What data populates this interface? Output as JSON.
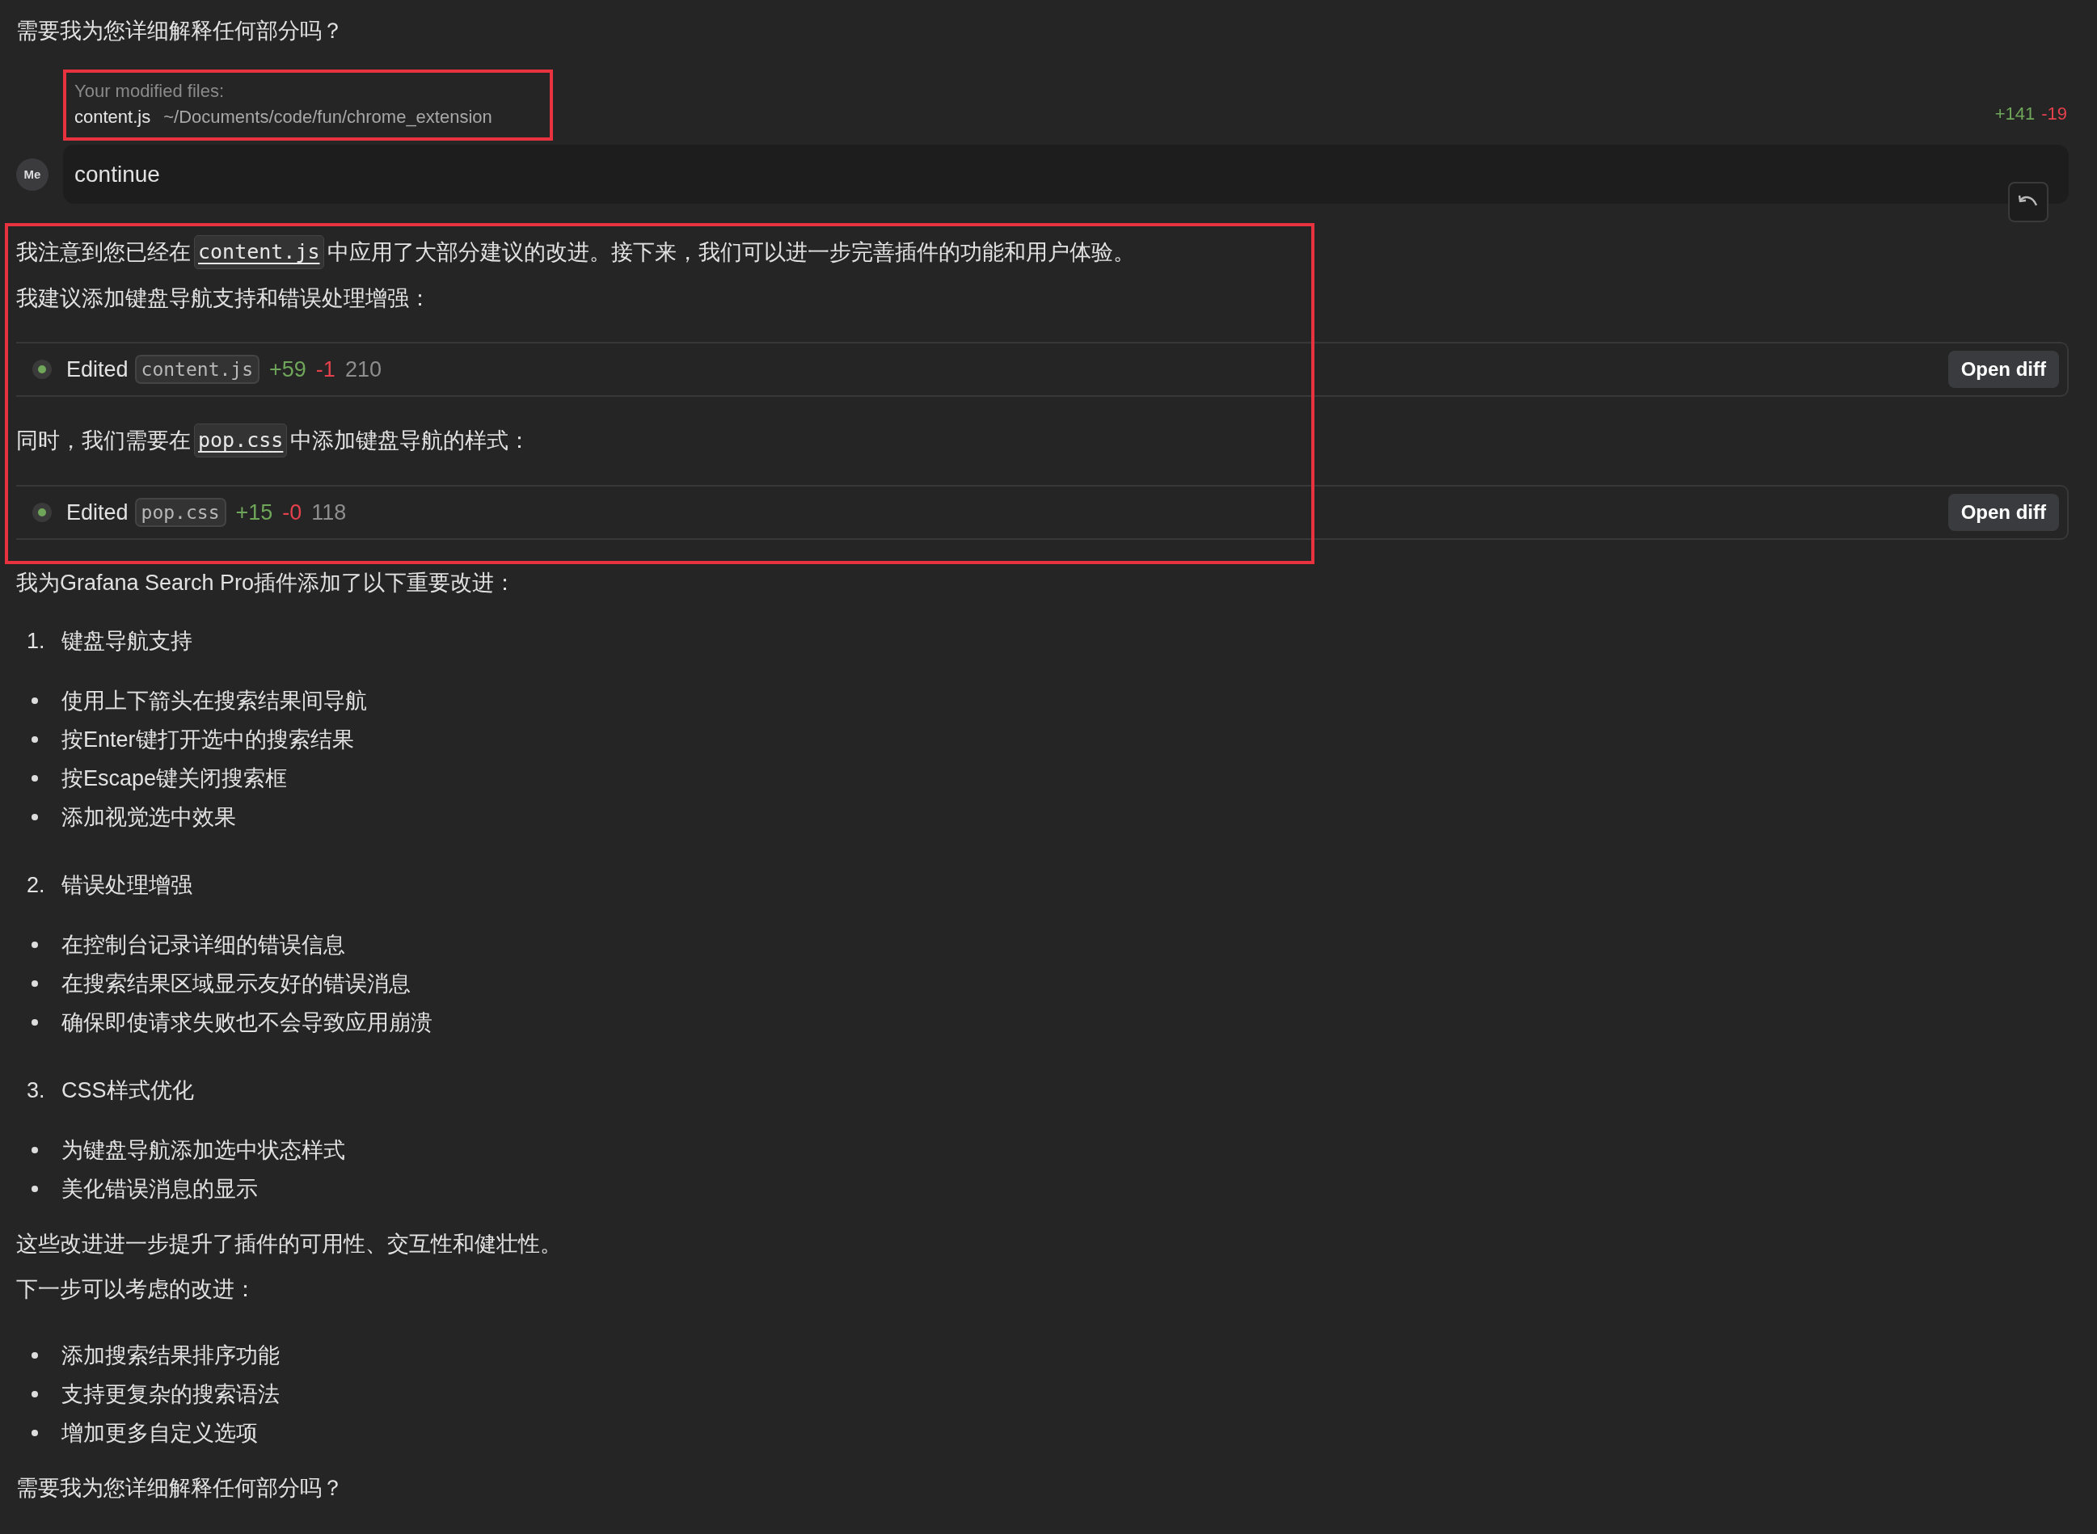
{
  "blocks": [
    {
      "kind": "paragraph",
      "segments": [
        {
          "kind": "text",
          "text": "需要我为您详细解释任何部分吗？"
        }
      ]
    },
    {
      "kind": "modified_files",
      "label": "Your modified files:",
      "file": "content.js",
      "path": "~/Documents/code/fun/chrome_extension",
      "added": "+141",
      "removed": "-19"
    },
    {
      "kind": "message",
      "avatar": "Me",
      "text": "continue"
    },
    {
      "kind": "paragraph",
      "segments": [
        {
          "kind": "text",
          "text": "我注意到您已经在"
        },
        {
          "kind": "code",
          "text": "content.js"
        },
        {
          "kind": "text",
          "text": "中应用了大部分建议的改进。接下来，我们可以进一步完善插件的功能和用户体验。"
        }
      ]
    },
    {
      "kind": "paragraph",
      "segments": [
        {
          "kind": "text",
          "text": "我建议添加键盘导航支持和错误处理增强："
        }
      ]
    },
    {
      "kind": "edit",
      "label": "Edited",
      "file": "content.js",
      "added": "+59",
      "removed": "-1",
      "lines": "210",
      "button": "Open diff"
    },
    {
      "kind": "paragraph",
      "segments": [
        {
          "kind": "text",
          "text": "同时，我们需要在"
        },
        {
          "kind": "code",
          "text": "pop.css"
        },
        {
          "kind": "text",
          "text": "中添加键盘导航的样式："
        }
      ]
    },
    {
      "kind": "edit",
      "label": "Edited",
      "file": "pop.css",
      "added": "+15",
      "removed": "-0",
      "lines": "118",
      "button": "Open diff"
    },
    {
      "kind": "paragraph",
      "segments": [
        {
          "kind": "text",
          "text": "我为Grafana Search Pro插件添加了以下重要改进："
        }
      ]
    },
    {
      "kind": "numbered",
      "number": "1.",
      "text": "键盘导航支持"
    },
    {
      "kind": "bullets",
      "items": [
        "使用上下箭头在搜索结果间导航",
        "按Enter键打开选中的搜索结果",
        "按Escape键关闭搜索框",
        "添加视觉选中效果"
      ]
    },
    {
      "kind": "numbered",
      "number": "2.",
      "text": "错误处理增强"
    },
    {
      "kind": "bullets",
      "items": [
        "在控制台记录详细的错误信息",
        "在搜索结果区域显示友好的错误消息",
        "确保即使请求失败也不会导致应用崩溃"
      ]
    },
    {
      "kind": "numbered",
      "number": "3.",
      "text": "CSS样式优化"
    },
    {
      "kind": "bullets",
      "items": [
        "为键盘导航添加选中状态样式",
        "美化错误消息的显示"
      ]
    },
    {
      "kind": "paragraph",
      "segments": [
        {
          "kind": "text",
          "text": "这些改进进一步提升了插件的可用性、交互性和健壮性。"
        }
      ]
    },
    {
      "kind": "paragraph",
      "segments": [
        {
          "kind": "text",
          "text": "下一步可以考虑的改进："
        }
      ]
    },
    {
      "kind": "bullets",
      "items": [
        "添加搜索结果排序功能",
        "支持更复杂的搜索语法",
        "增加更多自定义选项"
      ]
    },
    {
      "kind": "paragraph",
      "segments": [
        {
          "kind": "text",
          "text": "需要我为您详细解释任何部分吗？"
        }
      ]
    }
  ]
}
